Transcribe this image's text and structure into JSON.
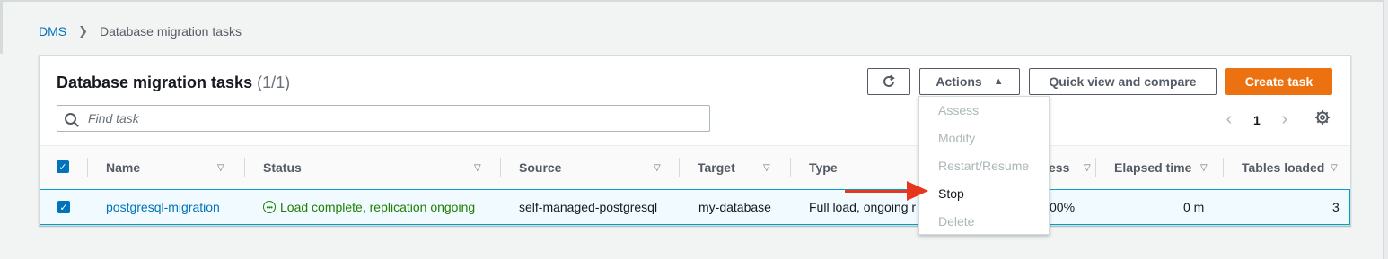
{
  "breadcrumb": {
    "root": "DMS",
    "current": "Database migration tasks"
  },
  "panel": {
    "title": "Database migration tasks",
    "count": "(1/1)"
  },
  "toolbar": {
    "actions_label": "Actions",
    "quick_view_label": "Quick view and compare",
    "create_label": "Create task"
  },
  "search": {
    "placeholder": "Find task"
  },
  "pager": {
    "current_page": "1"
  },
  "columns": [
    "Name",
    "Status",
    "Source",
    "Target",
    "Type",
    "Progress",
    "Elapsed time",
    "Tables loaded"
  ],
  "visible_headers": {
    "progress_partial": "ess"
  },
  "rows": [
    {
      "name": "postgresql-migration",
      "status": "Load complete, replication ongoing",
      "source": "self-managed-postgresql",
      "target": "my-database",
      "type": "Full load, ongoing r",
      "progress_partial": "00%",
      "elapsed": "0 m",
      "tables_loaded": "3"
    }
  ],
  "actions_menu": [
    "Assess",
    "Modify",
    "Restart/Resume",
    "Stop",
    "Delete"
  ],
  "colors": {
    "accent": "#0073bb",
    "primary_button": "#ec7211",
    "status_success": "#1d8102",
    "annotation_arrow": "#e8361c"
  }
}
